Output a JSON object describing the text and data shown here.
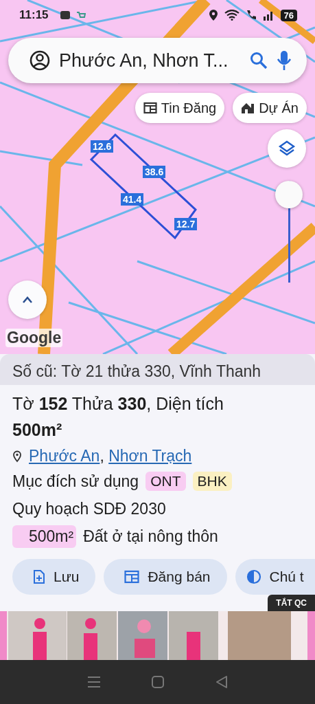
{
  "status_bar": {
    "time": "11:15",
    "battery": "76"
  },
  "search": {
    "query": "Phước An, Nhơn T..."
  },
  "map_chips": [
    {
      "label": "Tin Đăng",
      "kind": "listing"
    },
    {
      "label": "Dự Án",
      "kind": "project"
    }
  ],
  "map": {
    "kind": "picture",
    "parcel_edges": [
      "12.6",
      "38.6",
      "41.4",
      "12.7"
    ],
    "attribution": "Google",
    "layer_slider": {
      "level": 1
    }
  },
  "parcel": {
    "old_number": "Số cũ: Tờ 21 thửa 330, Vĩnh Thanh",
    "title": "Tờ **152** Thửa **330**, Diện tích **500m²**",
    "location_links": [
      "Phước An",
      "Nhơn Trạch"
    ],
    "location_separator": ", ",
    "usage_label": "Mục đích sử dụng",
    "usage_tags": [
      {
        "text": "ONT",
        "color": "#f8ccf2"
      },
      {
        "text": "BHK",
        "color": "#fbf0c2"
      }
    ],
    "planning": "Quy hoạch SDĐ 2030",
    "zones": [
      {
        "area": "500m²",
        "label": "Đất ở tại nông thôn",
        "color": "#f8ccf2"
      }
    ]
  },
  "actions": [
    {
      "label": "Lưu",
      "kind": "save"
    },
    {
      "label": "Đăng bán",
      "kind": "listing"
    },
    {
      "label": "Chú t",
      "kind": "contrast"
    }
  ],
  "ad": {
    "kind": "picture",
    "close_label": "TẮT QC"
  }
}
